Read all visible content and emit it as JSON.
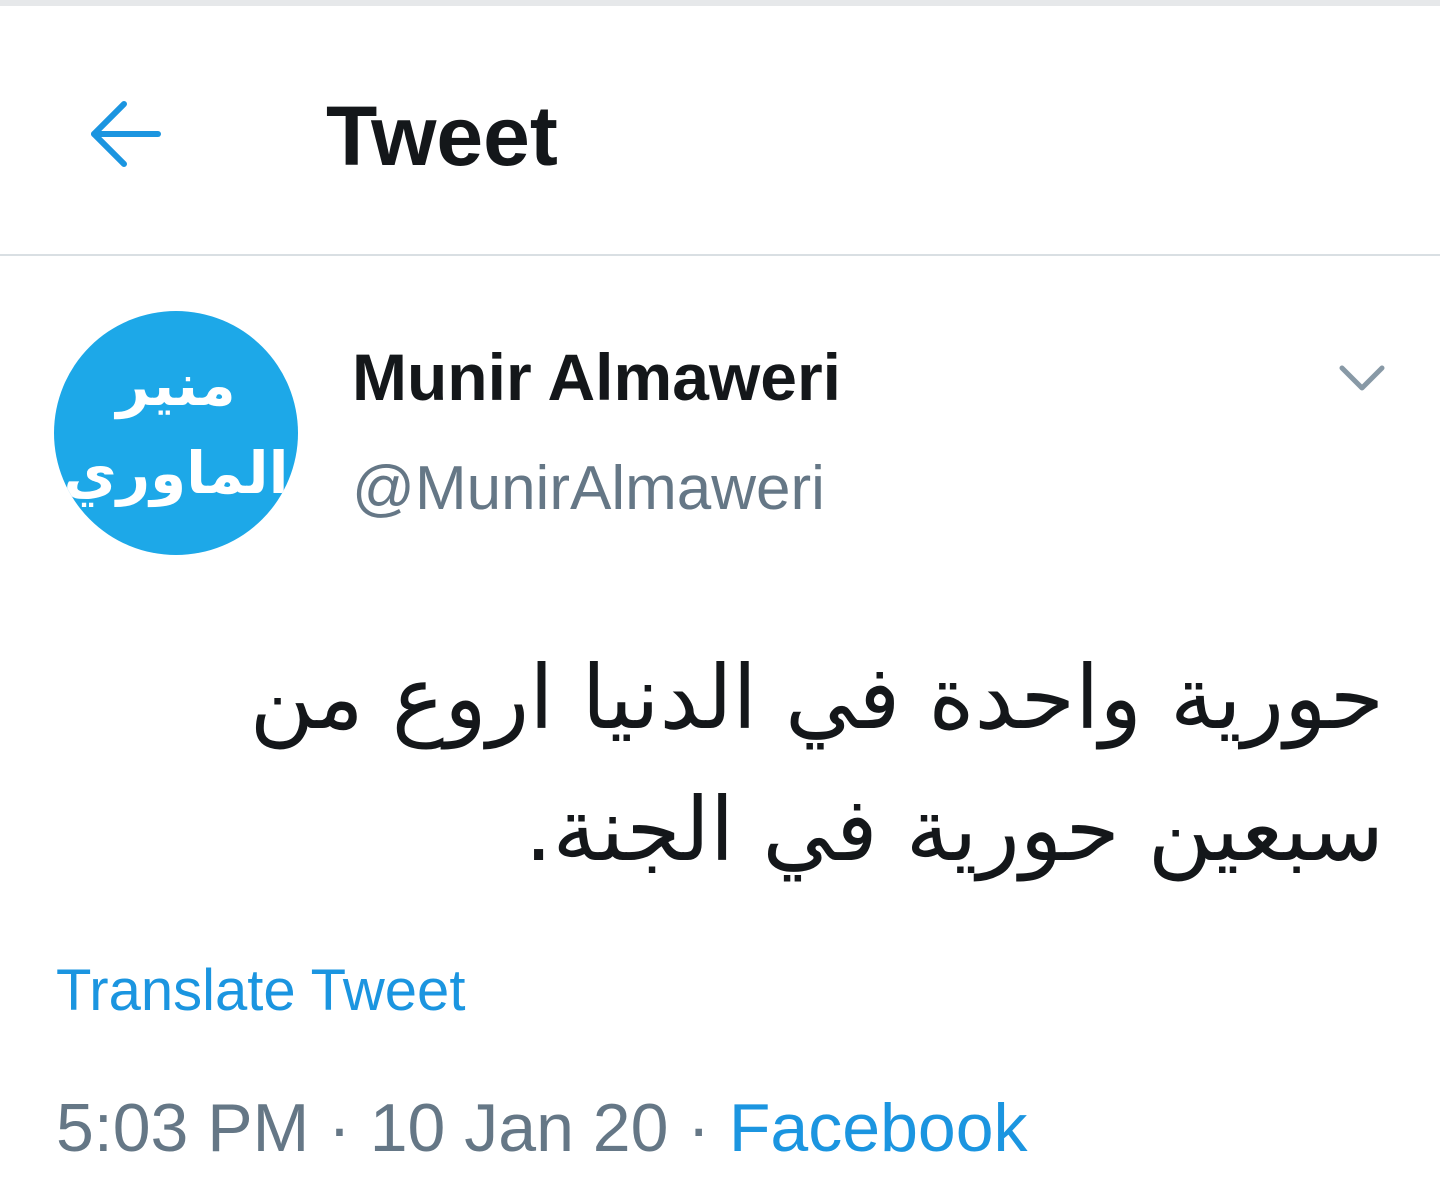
{
  "header": {
    "back_icon": "arrow-left-icon",
    "title": "Tweet"
  },
  "tweet": {
    "avatar": {
      "line1": "منير",
      "line2": "الماوري"
    },
    "display_name": "Munir Almaweri",
    "handle": "@MunirAlmaweri",
    "menu_icon": "chevron-down-icon",
    "text": "حورية واحدة في الدنيا اروع من سبعين حورية في الجنة.",
    "translate_label": "Translate Tweet",
    "time": "5:03 PM",
    "separator": "·",
    "date": "10 Jan 20",
    "source": "Facebook"
  },
  "colors": {
    "accent": "#1b95e0",
    "avatar_bg": "#1da8e8",
    "text_primary": "#14171a",
    "text_secondary": "#657786",
    "divider": "#d9dfe3"
  }
}
